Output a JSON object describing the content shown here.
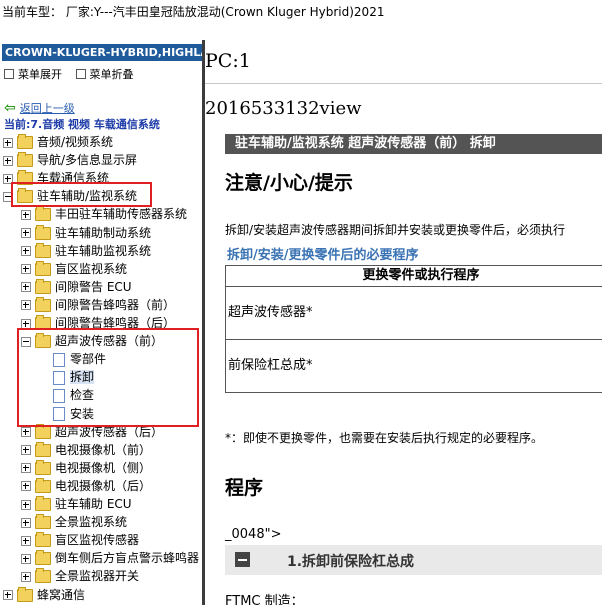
{
  "title_bar": "当前车型：  厂家:Y---汽丰田皇冠陆放混动(Crown Kluger Hybrid)2021",
  "left": {
    "nav_header": "CROWN-KLUGER-HYBRID,HIGHLAN",
    "menu_expand": "菜单展开",
    "menu_collapse": "菜单折叠",
    "back_link": "返回上一级",
    "current": "当前:7.音频 视频 车载通信系统",
    "tree": [
      {
        "label": "音频/视频系统",
        "level": 0,
        "icon": "folder",
        "toggle": "plus"
      },
      {
        "label": "导航/多信息显示屏",
        "level": 0,
        "icon": "folder",
        "toggle": "plus"
      },
      {
        "label": "车载通信系统",
        "level": 0,
        "icon": "folder",
        "toggle": "plus"
      },
      {
        "label": "驻车辅助/监视系统",
        "level": 0,
        "icon": "folder",
        "toggle": "minus"
      },
      {
        "label": "丰田驻车辅助传感器系统",
        "level": 1,
        "icon": "folder",
        "toggle": "plus"
      },
      {
        "label": "驻车辅助制动系统",
        "level": 1,
        "icon": "folder",
        "toggle": "plus"
      },
      {
        "label": "驻车辅助监视系统",
        "level": 1,
        "icon": "folder",
        "toggle": "plus"
      },
      {
        "label": "盲区监视系统",
        "level": 1,
        "icon": "folder",
        "toggle": "plus"
      },
      {
        "label": "间隙警告 ECU",
        "level": 1,
        "icon": "folder",
        "toggle": "plus"
      },
      {
        "label": "间隙警告蜂鸣器（前）",
        "level": 1,
        "icon": "folder",
        "toggle": "plus"
      },
      {
        "label": "间隙警告蜂鸣器（后）",
        "level": 1,
        "icon": "folder",
        "toggle": "plus"
      },
      {
        "label": "超声波传感器（前）",
        "level": 1,
        "icon": "folder",
        "toggle": "minus"
      },
      {
        "label": "零部件",
        "level": 2,
        "icon": "doc",
        "toggle": "none"
      },
      {
        "label": "拆卸",
        "level": 2,
        "icon": "doc",
        "toggle": "none",
        "selected": true
      },
      {
        "label": "检查",
        "level": 2,
        "icon": "doc",
        "toggle": "none"
      },
      {
        "label": "安装",
        "level": 2,
        "icon": "doc",
        "toggle": "none"
      },
      {
        "label": "超声波传感器（后）",
        "level": 1,
        "icon": "folder",
        "toggle": "plus"
      },
      {
        "label": "电视摄像机（前）",
        "level": 1,
        "icon": "folder",
        "toggle": "plus"
      },
      {
        "label": "电视摄像机（侧）",
        "level": 1,
        "icon": "folder",
        "toggle": "plus"
      },
      {
        "label": "电视摄像机（后）",
        "level": 1,
        "icon": "folder",
        "toggle": "plus"
      },
      {
        "label": "驻车辅助 ECU",
        "level": 1,
        "icon": "folder",
        "toggle": "plus"
      },
      {
        "label": "全景监视系统",
        "level": 1,
        "icon": "folder",
        "toggle": "plus"
      },
      {
        "label": "盲区监视传感器",
        "level": 1,
        "icon": "folder",
        "toggle": "plus"
      },
      {
        "label": "倒车侧后方盲点警示蜂鸣器",
        "level": 1,
        "icon": "folder",
        "toggle": "plus"
      },
      {
        "label": "全景监视器开关",
        "level": 1,
        "icon": "folder",
        "toggle": "plus"
      },
      {
        "label": "蜂窝通信",
        "level": 0,
        "icon": "folder",
        "toggle": "plus"
      }
    ]
  },
  "right": {
    "pc": "PC:1",
    "view_id": "2016533132view",
    "section_title": "驻车辅助/监视系统  超声波传感器（前）  拆卸",
    "notice_heading": "注意/小心/提示",
    "paragraph": "拆卸/安装超声波传感器期间拆卸并安装或更换零件后，必须执行",
    "subheading": "拆卸/安装/更换零件后的必要程序",
    "table": {
      "header": "更换零件或执行程序",
      "rows": [
        "超声波传感器*",
        "前保险杠总成*"
      ]
    },
    "note": "*：即使不更换零件，也需要在安装后执行规定的必要程序。",
    "procedure_heading": "程序",
    "code_fragment": "_0048\">",
    "step_title": "1.拆卸前保险杠总成",
    "ftmc": "FTMC 制造："
  },
  "colors": {
    "nav_header_bg": "#1f5a9b",
    "section_bar_bg": "#545454",
    "highlight_box": "#e02020",
    "subheading": "#3a73b3"
  }
}
